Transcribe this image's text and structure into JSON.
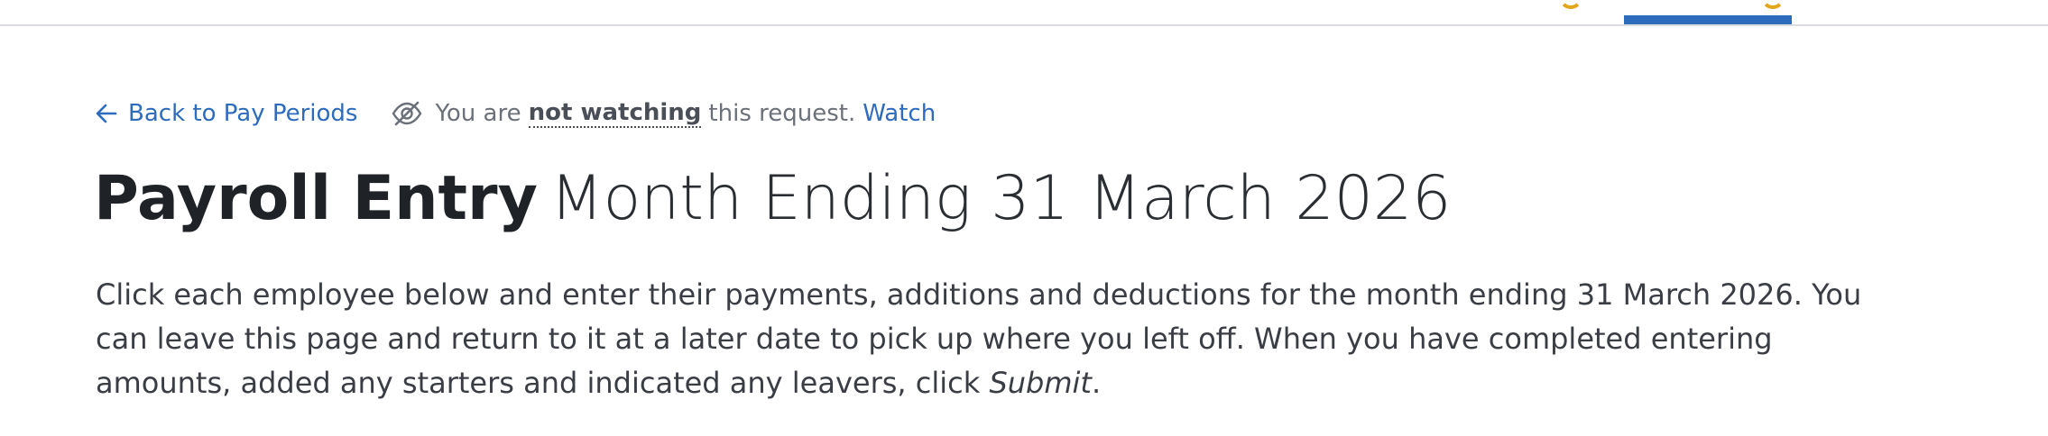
{
  "nav": {
    "active_tab": ""
  },
  "back_link": {
    "label": "Back to Pay Periods"
  },
  "watch": {
    "prefix": "You are",
    "status": "not watching",
    "suffix": "this request.",
    "action_label": "Watch"
  },
  "title": {
    "bold": "Payroll Entry",
    "light": "Month Ending 31 March 2026"
  },
  "instructions": {
    "text": "Click each employee below and enter their payments, additions and deductions for the month ending 31 March 2026. You can leave this page and return to it at a later date to pick up where you left off. When you have completed entering amounts, added any starters and indicated any leavers, click ",
    "emphasis": "Submit",
    "end": "."
  },
  "colors": {
    "link": "#2d6bbd",
    "nav_active": "#2d6bbd",
    "accent": "#e3a51b",
    "heading": "#1f2327",
    "muted": "#6b7079"
  },
  "icons": {
    "back": "arrow-left-icon",
    "watch": "eye-slash-icon"
  }
}
